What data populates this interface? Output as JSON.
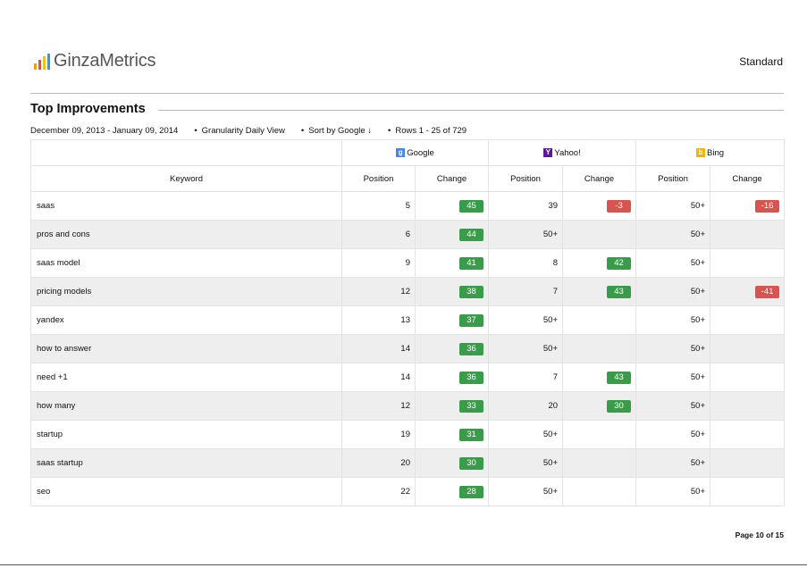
{
  "header": {
    "logo_text": "GinzaMetrics",
    "plan": "Standard"
  },
  "section": {
    "title": "Top Improvements"
  },
  "meta": {
    "date_range": "December 09, 2013 - January 09, 2014",
    "granularity": "Granularity Daily View",
    "sort": "Sort by Google ↓",
    "rows": "Rows 1 - 25 of 729"
  },
  "engines": [
    {
      "name": "Google",
      "icon": "google-icon",
      "icon_glyph": "g",
      "color": "#4a86e8"
    },
    {
      "name": "Yahoo!",
      "icon": "yahoo-icon",
      "icon_glyph": "Y",
      "color": "#5b1a9a"
    },
    {
      "name": "Bing",
      "icon": "bing-icon",
      "icon_glyph": "b",
      "color": "#f4b400"
    }
  ],
  "columns": {
    "keyword": "Keyword",
    "position": "Position",
    "change": "Change"
  },
  "colors": {
    "up": "#3a9b4a",
    "down": "#d9534f"
  },
  "rows": [
    {
      "keyword": "saas",
      "google_pos": "5",
      "google_chg": "45",
      "yahoo_pos": "39",
      "yahoo_chg": "-3",
      "bing_pos": "50+",
      "bing_chg": "-16"
    },
    {
      "keyword": "pros and cons",
      "google_pos": "6",
      "google_chg": "44",
      "yahoo_pos": "50+",
      "yahoo_chg": "",
      "bing_pos": "50+",
      "bing_chg": ""
    },
    {
      "keyword": "saas model",
      "google_pos": "9",
      "google_chg": "41",
      "yahoo_pos": "8",
      "yahoo_chg": "42",
      "bing_pos": "50+",
      "bing_chg": ""
    },
    {
      "keyword": "pricing models",
      "google_pos": "12",
      "google_chg": "38",
      "yahoo_pos": "7",
      "yahoo_chg": "43",
      "bing_pos": "50+",
      "bing_chg": "-41"
    },
    {
      "keyword": "yandex",
      "google_pos": "13",
      "google_chg": "37",
      "yahoo_pos": "50+",
      "yahoo_chg": "",
      "bing_pos": "50+",
      "bing_chg": ""
    },
    {
      "keyword": "how to answer",
      "google_pos": "14",
      "google_chg": "36",
      "yahoo_pos": "50+",
      "yahoo_chg": "",
      "bing_pos": "50+",
      "bing_chg": ""
    },
    {
      "keyword": "need +1",
      "google_pos": "14",
      "google_chg": "36",
      "yahoo_pos": "7",
      "yahoo_chg": "43",
      "bing_pos": "50+",
      "bing_chg": ""
    },
    {
      "keyword": "how many",
      "google_pos": "12",
      "google_chg": "33",
      "yahoo_pos": "20",
      "yahoo_chg": "30",
      "bing_pos": "50+",
      "bing_chg": ""
    },
    {
      "keyword": "startup",
      "google_pos": "19",
      "google_chg": "31",
      "yahoo_pos": "50+",
      "yahoo_chg": "",
      "bing_pos": "50+",
      "bing_chg": ""
    },
    {
      "keyword": "saas startup",
      "google_pos": "20",
      "google_chg": "30",
      "yahoo_pos": "50+",
      "yahoo_chg": "",
      "bing_pos": "50+",
      "bing_chg": ""
    },
    {
      "keyword": "seo",
      "google_pos": "22",
      "google_chg": "28",
      "yahoo_pos": "50+",
      "yahoo_chg": "",
      "bing_pos": "50+",
      "bing_chg": ""
    }
  ],
  "footer": {
    "page": "Page 10 of 15"
  }
}
